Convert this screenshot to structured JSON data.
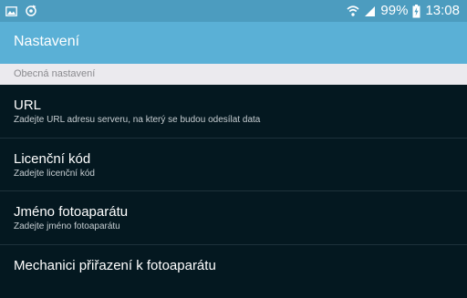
{
  "status_bar": {
    "battery_percent": "99%",
    "time": "13:08",
    "icons": [
      "image-icon",
      "sync-icon",
      "wifi-icon",
      "signal-icon",
      "battery-charging-icon"
    ]
  },
  "action_bar": {
    "title": "Nastavení"
  },
  "section": {
    "label": "Obecná nastavení"
  },
  "items": [
    {
      "title": "URL",
      "summary": "Zadejte URL adresu serveru, na který se budou odesílat data"
    },
    {
      "title": "Licenční kód",
      "summary": "Zadejte licenční kód"
    },
    {
      "title": "Jméno fotoaparátu",
      "summary": "Zadejte jméno fotoaparátu"
    },
    {
      "title": "Mechanici přiřazení k fotoaparátu",
      "summary": ""
    }
  ],
  "colors": {
    "status_bar": "#4c9cbf",
    "action_bar": "#5ab0d6",
    "background": "#041820",
    "section_header": "#ebeaee"
  }
}
